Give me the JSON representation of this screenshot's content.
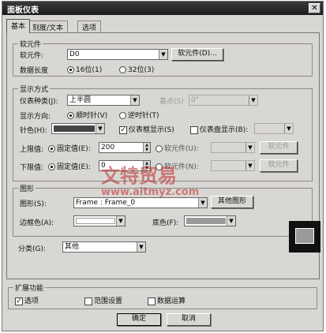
{
  "window": {
    "title": "面板仪表",
    "close_symbol": "✕"
  },
  "tabs": [
    {
      "label": "基本",
      "active": true
    },
    {
      "label": "刻度/文本",
      "active": false
    },
    {
      "label": "选项",
      "active": false
    }
  ],
  "soft_element": {
    "legend": "软元件",
    "element_label": "软元件:",
    "element_value": "D0",
    "element_button": "软元件(D)...",
    "data_length_label": "数据长度",
    "data_length_options": [
      "16位(1)",
      "32位(3)"
    ],
    "data_length_selected": "16位(1)"
  },
  "display": {
    "legend": "显示方式",
    "type_label": "仪表种类(J):",
    "type_value": "上半圆",
    "base_label": "基点(S)",
    "base_value": "0°",
    "direction_label": "显示方向:",
    "direction_options": [
      "顺时针(V)",
      "逆时针(T)"
    ],
    "direction_selected": "顺时针(V)",
    "needle_label": "针色(H):",
    "needle_color": "#444444",
    "frame_show_label": "仪表框显示(S)",
    "frame_show_checked": true,
    "panel_show_label": "仪表盘显示(B):",
    "panel_show_checked": false,
    "upper_label": "上限值:",
    "upper_fixed_label": "固定值(E):",
    "upper_value": "200",
    "upper_element_label": "软元件(U):",
    "upper_element_button": "软元件",
    "lower_label": "下限值:",
    "lower_fixed_label": "固定值(E):",
    "lower_value": "0",
    "lower_element_label": "软元件(N):",
    "lower_element_button": "软元件"
  },
  "figure": {
    "legend": "图形",
    "figure_label": "图形(S):",
    "figure_value": "Frame : Frame_0",
    "other_button": "其他图形",
    "border_color_label": "边框色(A):",
    "border_color": "#ffffff",
    "bg_color_label": "底色(F):",
    "bg_color": "#9a9a9a"
  },
  "category": {
    "label": "分类(G):",
    "value": "其他"
  },
  "extension": {
    "legend": "扩展功能",
    "options": [
      {
        "label": "选项",
        "checked": true
      },
      {
        "label": "范围设置",
        "checked": false
      },
      {
        "label": "数据运算",
        "checked": false
      }
    ]
  },
  "buttons": {
    "ok": "确定",
    "cancel": "取消"
  },
  "watermark": {
    "brand": "文特贸易",
    "url": "www.aitmyz.com"
  }
}
